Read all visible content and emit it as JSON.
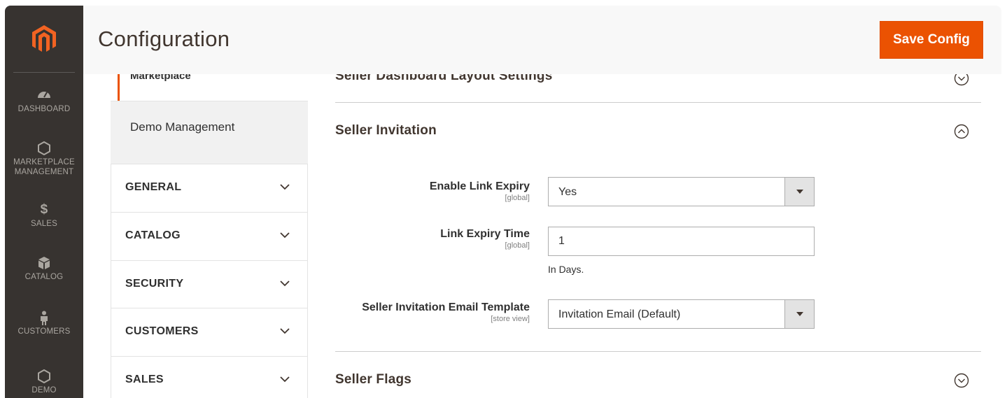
{
  "header": {
    "title": "Configuration",
    "save_label": "Save Config",
    "accent_color": "#eb5202"
  },
  "adminnav": {
    "items": [
      {
        "label": "DASHBOARD",
        "icon": "speedometer-icon"
      },
      {
        "label": "MARKETPLACE MANAGEMENT",
        "line1": "MARKETPLACE",
        "line2": "MANAGEMENT",
        "icon": "hexagon-icon"
      },
      {
        "label": "SALES",
        "icon": "dollar-icon"
      },
      {
        "label": "CATALOG",
        "icon": "box-icon"
      },
      {
        "label": "CUSTOMERS",
        "icon": "person-icon"
      },
      {
        "label": "DEMO",
        "icon": "hexagon-icon"
      }
    ]
  },
  "config_tabs": {
    "active_partial": "Marketplace",
    "demo_item": "Demo Management",
    "sections": [
      "GENERAL",
      "CATALOG",
      "SECURITY",
      "CUSTOMERS",
      "SALES"
    ]
  },
  "main": {
    "sections": {
      "dashboard_layout": "Seller Dashboard Layout Settings",
      "invitation": "Seller Invitation",
      "flags": "Seller Flags"
    },
    "fields": {
      "link_expiry": {
        "label": "Enable Link Expiry",
        "scope": "[global]",
        "value": "Yes"
      },
      "expiry_time": {
        "label": "Link Expiry Time",
        "scope": "[global]",
        "value": "1",
        "note": "In Days."
      },
      "email_template": {
        "label": "Seller Invitation Email Template",
        "scope": "[store view]",
        "value": "Invitation Email (Default)"
      }
    }
  }
}
